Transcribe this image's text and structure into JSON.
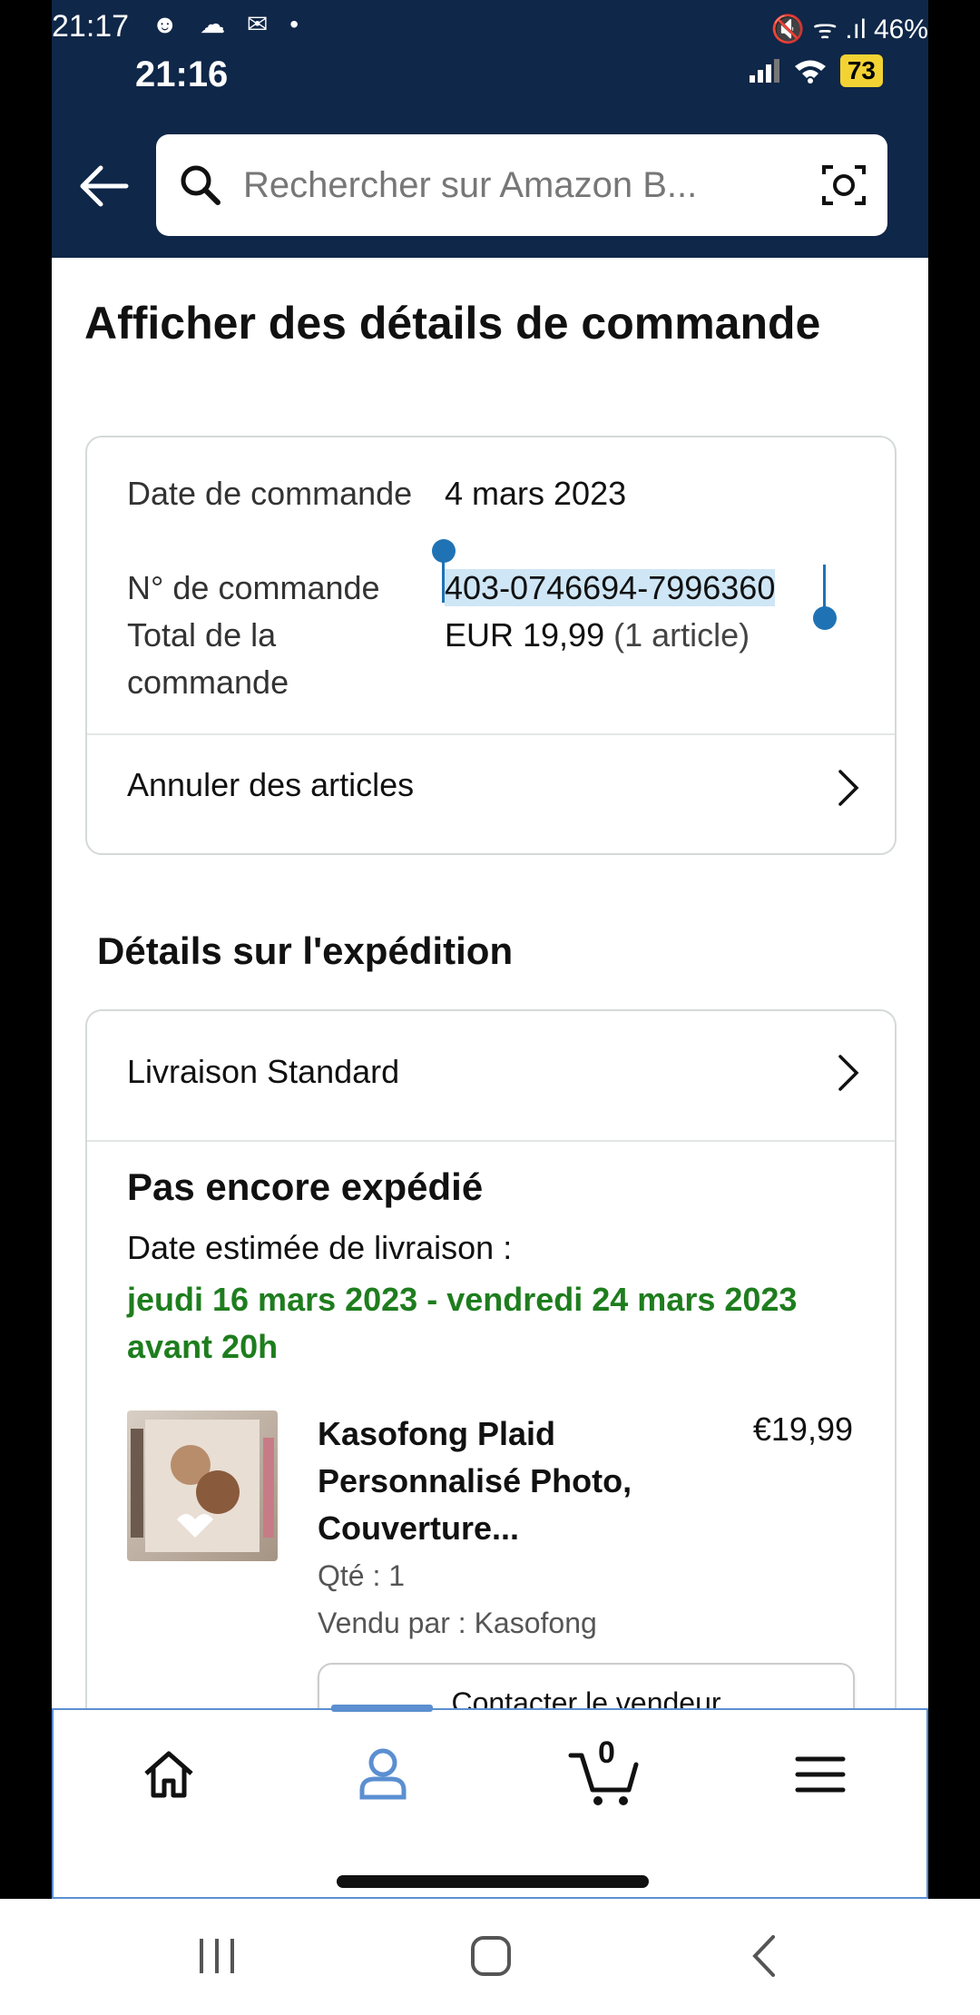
{
  "outer_status": {
    "time": "21:17",
    "notif_icons": "☻ ☁ ✉ •",
    "right": "🔇 ᯤ .ıl 46%"
  },
  "inner_status": {
    "time": "21:16",
    "battery": "73"
  },
  "search": {
    "placeholder": "Rechercher sur Amazon B..."
  },
  "page": {
    "title": "Afficher des détails de commande"
  },
  "order": {
    "date_label": "Date de commande",
    "date_value": "4 mars 2023",
    "number_label": "N° de commande",
    "number_value": "403-0746694-7996360",
    "total_label": "Total de la commande",
    "total_value": "EUR 19,99",
    "total_items": "(1 article)",
    "cancel_label": "Annuler des articles"
  },
  "shipping": {
    "section_title": "Détails sur l'expédition",
    "method": "Livraison Standard",
    "status": "Pas encore expédié",
    "estimate_label": "Date estimée de livraison :",
    "estimate_value": "jeudi 16 mars 2023 - vendredi 24 mars 2023 avant 20h",
    "estimate_color": "#1e7d1e"
  },
  "product": {
    "title": "Kasofong Plaid Personnalisé Photo, Couverture...",
    "price": "€19,99",
    "qty": "Qté : 1",
    "seller": "Vendu par : Kasofong",
    "contact_button": "Contacter le vendeur"
  },
  "bottom_nav": {
    "items": [
      "home-icon",
      "account-icon",
      "cart-icon",
      "menu-icon"
    ],
    "cart_count": "0",
    "active": "account",
    "accent": "#5b8fd1"
  },
  "colors": {
    "header": "#0f2748",
    "selection": "#cfe6f6",
    "handle": "#1f73b5"
  }
}
